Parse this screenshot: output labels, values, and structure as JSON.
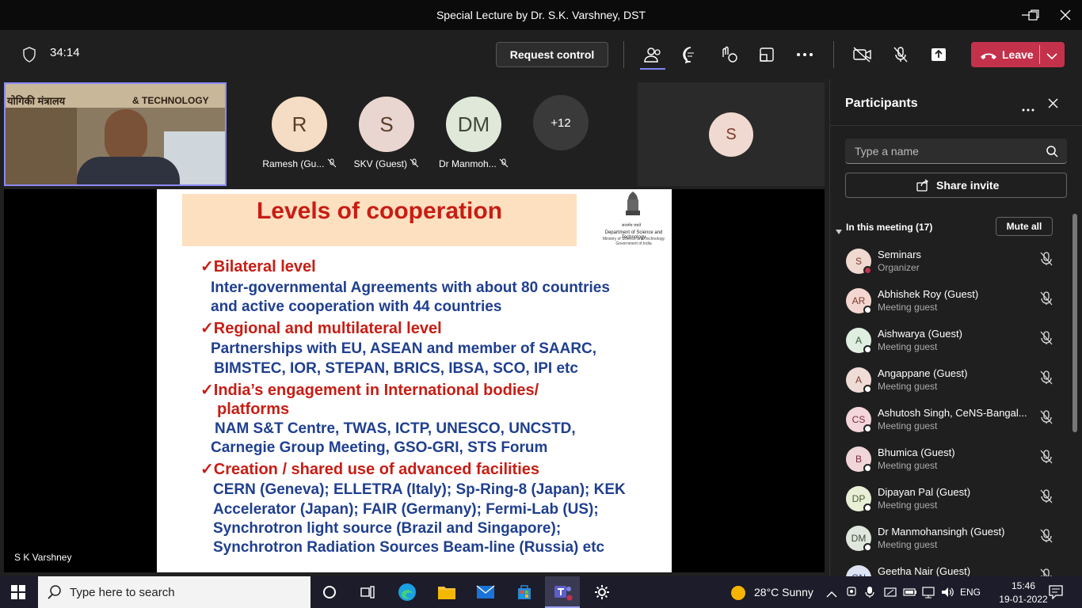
{
  "window": {
    "title": "Special Lecture by Dr. S.K. Varshney, DST"
  },
  "toolbar": {
    "timer": "34:14",
    "request_control": "Request control",
    "leave": "Leave"
  },
  "stage": {
    "avatars": [
      {
        "initials": "R",
        "name": "Ramesh (Gu...",
        "color": "#f5dcc4"
      },
      {
        "initials": "S",
        "name": "SKV (Guest)",
        "color": "#ead6d0"
      },
      {
        "initials": "DM",
        "name": "Dr Manmoh...",
        "color": "#dfe8d9"
      }
    ],
    "more_count": "+12",
    "s_tile_initial": "S",
    "presenter_name": "S K Varshney",
    "self_video_sign": "योगिकी मंत्रालय",
    "self_video_sign2": "& TECHNOLOGY"
  },
  "slide": {
    "title": "Levels of cooperation",
    "logo_text": "Department of Science and Technology",
    "logo_sub1": "Ministry of Science and Technology",
    "logo_sub2": "Government of India",
    "logo_hindi": "सत्यमेव जयते",
    "check": "✓",
    "lines": {
      "h1": "Bilateral level",
      "b1a": "Inter-governmental Agreements with about 80 countries",
      "b1b": "and active cooperation with 44 countries",
      "h2": "Regional and multilateral level",
      "b2a": "Partnerships with EU, ASEAN and member of SAARC,",
      "b2b": "BIMSTEC, IOR, STEPAN, BRICS, IBSA, SCO, IPI etc",
      "h3a": "India’s engagement in International bodies/",
      "h3b": "platforms",
      "b3a": "NAM S&T Centre, TWAS, ICTP, UNESCO, UNCSTD,",
      "b3b": "Carnegie Group Meeting, GSO-GRI, STS Forum",
      "h4": "Creation / shared use of advanced facilities",
      "b4a": "CERN (Geneva); ELLETRA (Italy); Sp-Ring-8 (Japan); KEK",
      "b4b": "Accelerator (Japan); FAIR (Germany); Fermi-Lab (US);",
      "b4c": "Synchrotron light source (Brazil and Singapore);",
      "b4d": "Synchrotron Radiation Sources Beam-line (Russia) etc"
    }
  },
  "panel": {
    "title": "Participants",
    "search_placeholder": "Type a name",
    "share_invite": "Share invite",
    "in_meeting": "In this meeting (17)",
    "mute_all": "Mute all",
    "participants": [
      {
        "initials": "S",
        "name": "Seminars",
        "role": "Organizer",
        "bg": "#f0d9d0",
        "fg": "#7b3b2b",
        "dot": "#c4314b"
      },
      {
        "initials": "AR",
        "name": "Abhishek Roy (Guest)",
        "role": "Meeting guest",
        "bg": "#f3d6d0",
        "fg": "#7b3b2b",
        "dot": "#ffffff"
      },
      {
        "initials": "A",
        "name": "Aishwarya (Guest)",
        "role": "Meeting guest",
        "bg": "#dfeee0",
        "fg": "#2f5a35",
        "dot": "#ffffff"
      },
      {
        "initials": "A",
        "name": "Angappane (Guest)",
        "role": "Meeting guest",
        "bg": "#f0dcd6",
        "fg": "#7b3b2b",
        "dot": "#ffffff"
      },
      {
        "initials": "CS",
        "name": "Ashutosh Singh, CeNS-Bangal...",
        "role": "Meeting guest",
        "bg": "#f3d6dc",
        "fg": "#7b2b3b",
        "dot": "#ffffff"
      },
      {
        "initials": "B",
        "name": "Bhumica (Guest)",
        "role": "Meeting guest",
        "bg": "#f0d6d9",
        "fg": "#7b2b3b",
        "dot": "#ffffff"
      },
      {
        "initials": "DP",
        "name": "Dipayan Pal (Guest)",
        "role": "Meeting guest",
        "bg": "#e8efd6",
        "fg": "#4f5a2f",
        "dot": "#ffffff"
      },
      {
        "initials": "DM",
        "name": "Dr Manmohansingh (Guest)",
        "role": "Meeting guest",
        "bg": "#dfe6dc",
        "fg": "#3f4a3a",
        "dot": "#ffffff"
      },
      {
        "initials": "GN",
        "name": "Geetha Nair (Guest)",
        "role": "",
        "bg": "#dde3f3",
        "fg": "#2b3b7b",
        "dot": "#ffffff"
      }
    ]
  },
  "taskbar": {
    "search": "Type here to search",
    "weather": "28°C  Sunny",
    "lang": "ENG",
    "time": "15:46",
    "date": "19-01-2022"
  }
}
